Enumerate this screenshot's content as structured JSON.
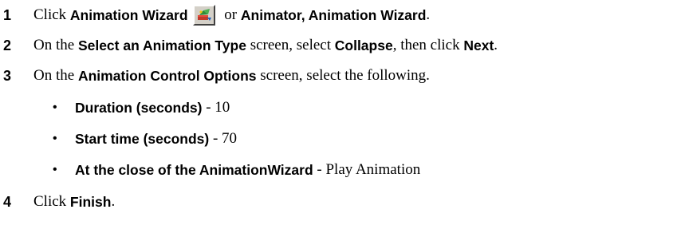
{
  "steps": [
    {
      "number": "1",
      "parts": [
        "Click ",
        "Animation Wizard",
        " or ",
        "Animator, Animation Wizard",
        "."
      ],
      "icon": "animation-wizard-icon"
    },
    {
      "number": "2",
      "parts": [
        "On the ",
        "Select an Animation Type",
        " screen, select ",
        "Collapse",
        ", then click ",
        "Next",
        "."
      ]
    },
    {
      "number": "3",
      "parts": [
        "On the ",
        "Animation Control Options",
        " screen, select the following."
      ],
      "bullets": [
        {
          "label": "Duration (seconds)",
          "value": " - 10"
        },
        {
          "label": "Start time (seconds)",
          "value": " - 70"
        },
        {
          "label": "At the close of the AnimationWizard",
          "value": " - Play Animation"
        }
      ]
    },
    {
      "number": "4",
      "parts": [
        "Click ",
        "Finish",
        "."
      ]
    }
  ],
  "bullet_glyph": "•"
}
